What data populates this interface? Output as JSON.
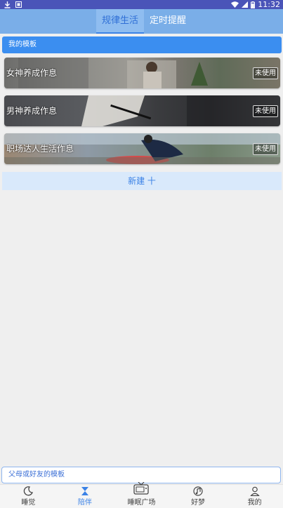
{
  "status_bar": {
    "time": "11:32"
  },
  "header": {
    "tabs": [
      {
        "label": "规律生活"
      },
      {
        "label": "定时提醒"
      }
    ]
  },
  "my_templates": {
    "title": "我的模板",
    "items": [
      {
        "label": "女神养成作息",
        "badge": "未使用"
      },
      {
        "label": "男神养成作息",
        "badge": "未使用"
      },
      {
        "label": "职场达人生活作息",
        "badge": "未使用"
      }
    ]
  },
  "new_button": {
    "label": "新建 十"
  },
  "parents_templates": {
    "label": "父母或好友的模板"
  },
  "bottom_nav": {
    "items": [
      {
        "label": "睡觉",
        "icon": "moon-icon"
      },
      {
        "label": "陪伴",
        "icon": "hourglass-icon"
      },
      {
        "label": "睡眠广场",
        "icon": "tv-icon"
      },
      {
        "label": "好梦",
        "icon": "music-icon"
      },
      {
        "label": "我的",
        "icon": "person-icon"
      }
    ]
  },
  "colors": {
    "accent": "#3b82e6",
    "header": "#7aaee8",
    "status_bar": "#4a54b8"
  }
}
